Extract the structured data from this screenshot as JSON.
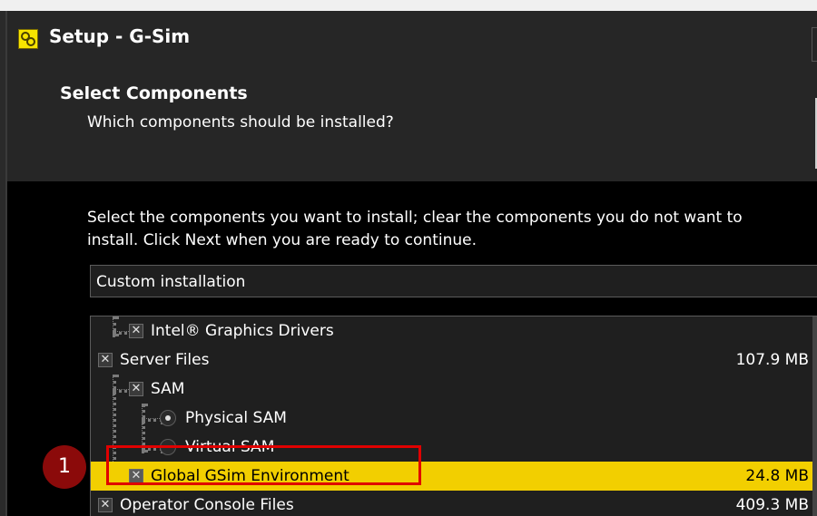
{
  "window": {
    "title": "Setup - G-Sim",
    "icon": "gears-icon"
  },
  "header": {
    "section_title": "Select Components",
    "section_subtitle": "Which components should be installed?"
  },
  "content": {
    "instructions_line1": "Select the components you want to install; clear the components you do not want to",
    "instructions_line2": "install. Click Next when you are ready to continue.",
    "installation_type": "Custom installation"
  },
  "components": [
    {
      "label": "Intel® Graphics Drivers",
      "size": "",
      "control": "checkbox",
      "checked": true
    },
    {
      "label": "Server Files",
      "size": "107.9 MB",
      "control": "checkbox",
      "checked": true
    },
    {
      "label": "SAM",
      "size": "",
      "control": "checkbox",
      "checked": true
    },
    {
      "label": "Physical SAM",
      "size": "",
      "control": "radio",
      "checked": true
    },
    {
      "label": "Virtual SAM",
      "size": "",
      "control": "radio",
      "checked": false
    },
    {
      "label": "Global GSim Environment",
      "size": "24.8 MB",
      "control": "checkbox",
      "checked": true,
      "highlighted": true
    },
    {
      "label": "Operator Console Files",
      "size": "409.3 MB",
      "control": "checkbox",
      "checked": true
    }
  ],
  "callout": {
    "number": "1"
  },
  "colors": {
    "highlight": "#f2cf00",
    "callout_border": "#e00000",
    "callout_badge": "#8b0a0a"
  }
}
